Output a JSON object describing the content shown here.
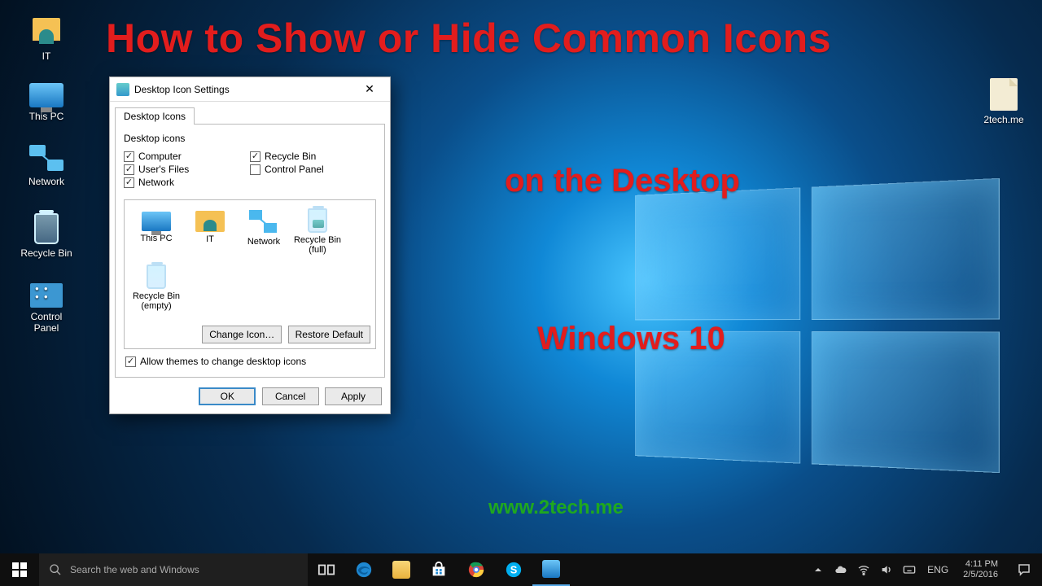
{
  "overlay": {
    "title_line": "How to Show or Hide Common Icons",
    "subtitle_1": "on the Desktop",
    "subtitle_2": "Windows 10",
    "url": "www.2tech.me"
  },
  "desktop_icons": {
    "user": "IT",
    "this_pc": "This PC",
    "network": "Network",
    "recycle": "Recycle Bin",
    "control_panel": "Control\nPanel",
    "right_file": "2tech.me"
  },
  "dialog": {
    "title": "Desktop Icon Settings",
    "tab": "Desktop Icons",
    "group_label": "Desktop icons",
    "checks": {
      "computer": "Computer",
      "users_files": "User's Files",
      "network": "Network",
      "recycle_bin": "Recycle Bin",
      "control_panel": "Control Panel"
    },
    "preview": {
      "this_pc": "This PC",
      "it": "IT",
      "network": "Network",
      "bin_full": "Recycle Bin (full)",
      "bin_empty": "Recycle Bin (empty)"
    },
    "buttons": {
      "change_icon": "Change Icon…",
      "restore": "Restore Default",
      "ok": "OK",
      "cancel": "Cancel",
      "apply": "Apply"
    },
    "allow_themes": "Allow themes to change desktop icons"
  },
  "taskbar": {
    "search_placeholder": "Search the web and Windows",
    "lang": "ENG",
    "time": "4:11 PM",
    "date": "2/5/2016"
  }
}
